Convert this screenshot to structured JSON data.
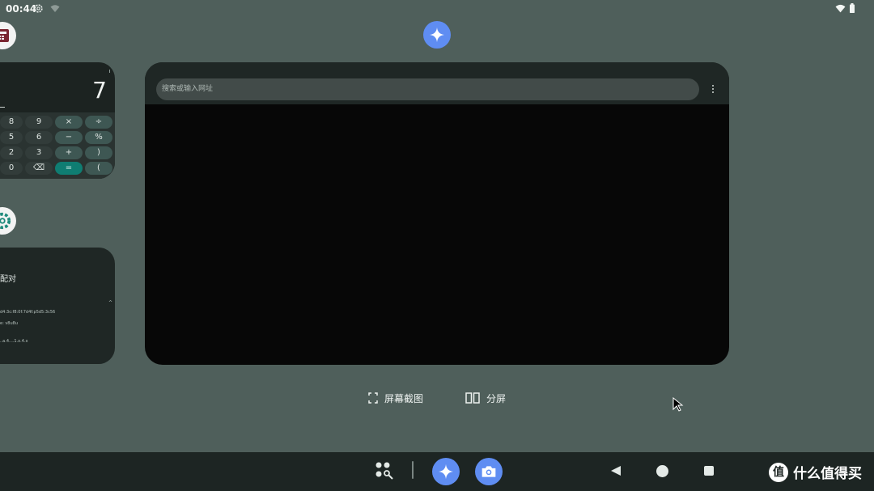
{
  "status_bar": {
    "time": "00:44",
    "icons": [
      "gear-icon",
      "wifi-off-icon",
      "wifi-icon",
      "battery-icon"
    ]
  },
  "recents": {
    "calculator": {
      "icon": "calculator-icon",
      "display": "7",
      "keys": [
        [
          "8",
          "9",
          "×",
          "÷"
        ],
        [
          "5",
          "6",
          "−",
          "%"
        ],
        [
          "2",
          "3",
          "+",
          ")"
        ],
        [
          "0",
          "⌫",
          "=",
          "("
        ]
      ]
    },
    "settings": {
      "icon": "settings-icon",
      "title": "配对",
      "lines": [
        "d4:3c:f8:0f:7d4f:p5d5:3c56",
        "e: v8u8u",
        "..a.4....1.x.4.x"
      ],
      "arrow": "^"
    },
    "browser": {
      "url_placeholder": "搜索或输入网址",
      "menu_icon": "more-vert-icon"
    }
  },
  "actions": {
    "screenshot_label": "屏幕截图",
    "split_label": "分屏"
  },
  "taskbar": {
    "items": [
      "app-drawer-icon",
      "gemini-icon",
      "camera-icon"
    ],
    "nav": [
      "back-icon",
      "home-icon",
      "recents-icon"
    ]
  },
  "watermark": {
    "logo": "值",
    "text": "什么值得买"
  },
  "colors": {
    "background": "#4f5f5b",
    "accent_blue": "#5f8df2",
    "equals_teal": "#0f7d72"
  }
}
